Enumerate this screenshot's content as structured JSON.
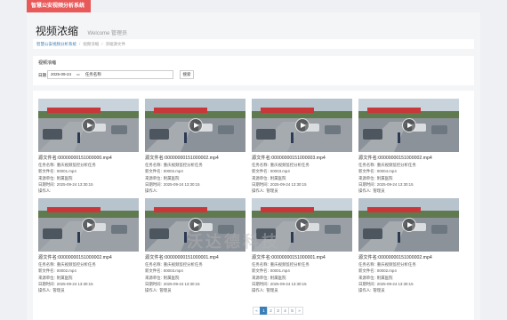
{
  "app": {
    "brand": "智慧公安视频分析系统"
  },
  "header": {
    "title": "视频浓缩",
    "welcome": "Welcome 管理员"
  },
  "breadcrumb": [
    "智慧公安视频分析系统",
    "视频浓缩",
    "浓缩源文件"
  ],
  "filter": {
    "title": "视频浓缩",
    "date_label": "日期",
    "date_value": "2025-09-24",
    "task_label": "任务名称",
    "search_label": "搜索"
  },
  "field_labels": {
    "task": "任务名称:",
    "new_file": "新文件名:",
    "source": "来源单位:",
    "date": "日期时间:",
    "operator": "操作人:"
  },
  "cards": [
    {
      "filename": "源文件名:00000000151000000.mp4",
      "task": "重庆视频监控分析任务",
      "new_file": "00001.mp4",
      "source": "附属医院",
      "date": "2025-09-24 13:30:15",
      "operator": ""
    },
    {
      "filename": "源文件名:00000000151000002.mp4",
      "task": "重庆视频监控分析任务",
      "new_file": "00002.mp4",
      "source": "附属医院",
      "date": "2025-09-24 13:30:15",
      "operator": ""
    },
    {
      "filename": "源文件名:00000000151000003.mp4",
      "task": "重庆视频监控分析任务",
      "new_file": "00003.mp4",
      "source": "附属医院",
      "date": "2025-09-24 13:30:15",
      "operator": "管理员"
    },
    {
      "filename": "源文件名:00000000151000002.mp4",
      "task": "重庆视频监控分析任务",
      "new_file": "00004.mp4",
      "source": "附属医院",
      "date": "2025-09-24 13:30:15",
      "operator": "管理员"
    },
    {
      "filename": "源文件名:00000000151000002.mp4",
      "task": "重庆视频监控分析任务",
      "new_file": "00002.mp4",
      "source": "附属医院",
      "date": "2025-09-24 13:30:15",
      "operator": "管理员"
    },
    {
      "filename": "源文件名:00000000151000001.mp4",
      "task": "重庆视频监控分析任务",
      "new_file": "00003.mp4",
      "source": "附属医院",
      "date": "2025-09-24 13:30:15",
      "operator": "管理员"
    },
    {
      "filename": "源文件名:00000000151000001.mp4",
      "task": "重庆视频监控分析任务",
      "new_file": "00001.mp4",
      "source": "附属医院",
      "date": "2025-09-24 13:30:15",
      "operator": "管理员"
    },
    {
      "filename": "源文件名:00000000151000002.mp4",
      "task": "重庆视频监控分析任务",
      "new_file": "00002.mp4",
      "source": "附属医院",
      "date": "2025-09-24 13:30:15",
      "operator": "管理员"
    }
  ],
  "pagination": {
    "prev": "«",
    "pages": [
      "1",
      "2",
      "3",
      "4",
      "5"
    ],
    "next": "»",
    "active": "1"
  },
  "watermark": "沃达德科技",
  "colors": {
    "brand": "#e8595a",
    "accent": "#3a7fb8"
  }
}
